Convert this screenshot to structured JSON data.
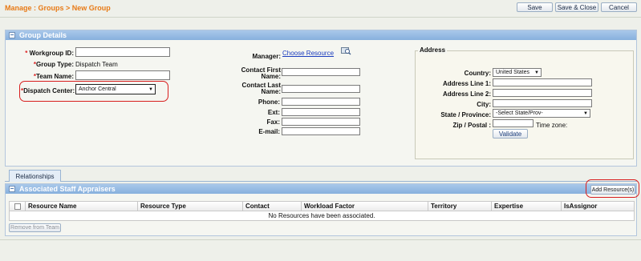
{
  "header": {
    "breadcrumb": "Manage : Groups > New Group",
    "save_label": "Save",
    "save_close_label": "Save & Close",
    "cancel_label": "Cancel"
  },
  "group_details": {
    "title": "Group Details",
    "toggle_symbol": "−",
    "workgroup_id_label": "Workgroup ID:",
    "workgroup_id_value": "",
    "group_type_label": "Group Type:",
    "group_type_value": "Dispatch Team",
    "team_name_label": "Team Name:",
    "team_name_value": "",
    "dispatch_center_label": "Dispatch Center:",
    "dispatch_center_value": "Anchor Central",
    "required_mark": "*",
    "manager_label": "Manager:",
    "choose_resource_label": "Choose Resource",
    "contact_first_name_label_1": "Contact First",
    "contact_first_name_label_2": "Name:",
    "contact_last_name_label_1": "Contact Last",
    "contact_last_name_label_2": "Name:",
    "phone_label": "Phone:",
    "ext_label": "Ext:",
    "fax_label": "Fax:",
    "email_label": "E-mail:",
    "address": {
      "legend": "Address",
      "country_label": "Country:",
      "country_value": "United States",
      "line1_label": "Address Line 1:",
      "line2_label": "Address Line 2:",
      "city_label": "City:",
      "state_label": "State / Province:",
      "state_value": "-Select State/Prov-",
      "zip_label": "Zip / Postal :",
      "timezone_label": "Time zone:",
      "validate_label": "Validate"
    }
  },
  "relationships_tab": "Relationships",
  "staff": {
    "title": "Associated Staff Appraisers",
    "toggle_symbol": "−",
    "add_resource_label": "Add Resource(s)",
    "columns": [
      "Resource Name",
      "Resource Type",
      "Contact",
      "Workload Factor",
      "Territory",
      "Expertise",
      "IsAssignor"
    ],
    "empty_message": "No Resources have been associated.",
    "remove_label": "Remove from Team"
  },
  "colors": {
    "accent_orange": "#e87a16",
    "panel_blue": "#87b0dd",
    "highlight_red": "#d81e1e",
    "link_blue": "#1a3cbe"
  }
}
